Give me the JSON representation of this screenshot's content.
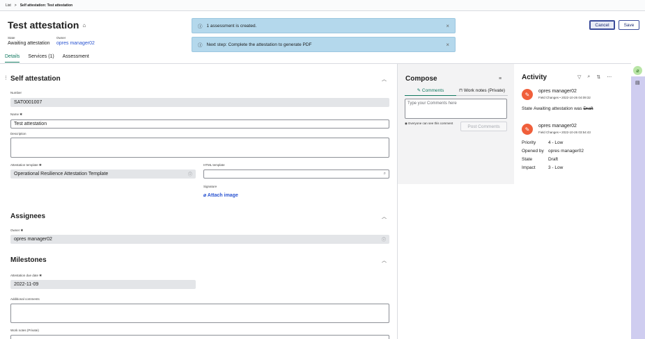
{
  "breadcrumb": {
    "list": "List",
    "separator": ">",
    "current": "Self attestation: Test attestation"
  },
  "header": {
    "title": "Test attestation",
    "state_label": "State",
    "state_value": "Awaiting attestation",
    "owner_label": "Owner",
    "owner_value": "opres manager02",
    "cancel_label": "Cancel",
    "save_label": "Save"
  },
  "tabs": [
    {
      "label": "Details"
    },
    {
      "label": "Services (1)"
    },
    {
      "label": "Assessment"
    }
  ],
  "toasts": [
    {
      "text": "1 assessment is created."
    },
    {
      "text": "Next step: Complete the attestation to generate PDF"
    }
  ],
  "self_attestation": {
    "section_title": "Self attestation",
    "number_label": "Number",
    "number_value": "SAT0001007",
    "name_label": "Name",
    "name_value": "Test attestation",
    "description_label": "Description",
    "template_label": "Attestation template",
    "template_value": "Operational Resilience Attestation Template",
    "html_template_label": "HTML template",
    "signature_label": "Signature",
    "attach_image_label": "Attach image"
  },
  "assignees": {
    "section_title": "Assignees",
    "owner_label": "Owner",
    "owner_value": "opres manager02"
  },
  "milestones": {
    "section_title": "Milestones",
    "due_date_label": "Attestation due date",
    "due_date_value": "2022-11-09",
    "additional_comments_label": "Additional comments",
    "work_notes_label": "Work notes (Private)"
  },
  "compose": {
    "title": "Compose",
    "tab_comments": "Comments",
    "tab_work_notes": "Work notes (Private)",
    "placeholder": "Type your Comments here",
    "visibility_text": "Everyone can see this comment",
    "post_label": "Post Comments"
  },
  "activity": {
    "title": "Activity",
    "entries": [
      {
        "user": "opres manager02",
        "meta": "Field Changes • 2022-10-26 04:09:32",
        "state_key": "State",
        "state_new": "Awaiting attestation",
        "state_was": "was",
        "state_old": "Draft"
      },
      {
        "user": "opres manager02",
        "meta": "Field Changes • 2022-10-26 03:54:43",
        "fields": [
          {
            "key": "Priority",
            "value": "4 - Low"
          },
          {
            "key": "Opened by",
            "value": "opres manager02"
          },
          {
            "key": "State",
            "value": "Draft"
          },
          {
            "key": "Impact",
            "value": "3 - Low"
          }
        ]
      }
    ]
  },
  "colors": {
    "accent_green": "#10785f",
    "link_blue": "#2a54d1",
    "toast_bg": "#b4d8ec",
    "avatar": "#f05f3b",
    "rail": "#cfcdf0"
  }
}
